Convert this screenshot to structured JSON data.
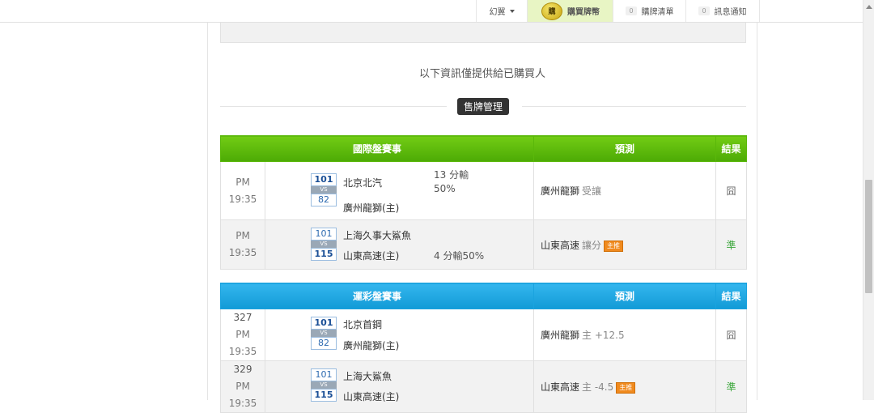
{
  "topbar": {
    "menu_label": "幻翼",
    "buy_coin_icon": "coin-icon",
    "buy_coin_text": "購",
    "buy_label": "購買牌幣",
    "list_count": "0",
    "list_label": "購牌清單",
    "msg_count": "0",
    "msg_label": "訊息通知"
  },
  "main": {
    "info_text": "以下資訊僅提供給已購買人",
    "manage_label": "售牌管理"
  },
  "intl_table": {
    "header": "國際盤賽事",
    "pred_header": "預測",
    "result_header": "結果",
    "rows": [
      {
        "time": "PM 19:35",
        "score_top": "101",
        "score_bottom": "82",
        "vs": "VS",
        "team1": "北京北汽",
        "team2": "廣州龍獅(主)",
        "odds_line1": "13 分輸",
        "odds_line2": "50%",
        "pred_team": "廣州龍獅",
        "pred_sub": "受讓",
        "pred_tag": "",
        "result": "囧"
      },
      {
        "time": "PM 19:35",
        "score_top": "101",
        "score_bottom": "115",
        "vs": "VS",
        "team1": "上海久事大鯊魚",
        "team2": "山東高速(主)",
        "odds_line1": "",
        "odds_line2": "4 分輸50%",
        "pred_team": "山東高速",
        "pred_sub": "讓分",
        "pred_tag": "主推",
        "result": "準"
      }
    ]
  },
  "lottery_table": {
    "header": "運彩盤賽事",
    "pred_header": "預測",
    "result_header": "結果",
    "rows": [
      {
        "num": "327",
        "time": "PM 19:35",
        "score_top": "101",
        "score_bottom": "82",
        "vs": "VS",
        "team1": "北京首鋼",
        "team2": "廣州龍獅(主)",
        "pred_team": "廣州龍獅",
        "pred_sub": "主 +12.5",
        "pred_tag": "",
        "result": "囧"
      },
      {
        "num": "329",
        "time": "PM 19:35",
        "score_top": "101",
        "score_bottom": "115",
        "vs": "VS",
        "team1": "上海大鯊魚",
        "team2": "山東高速(主)",
        "pred_team": "山東高速",
        "pred_sub": "主 -4.5",
        "pred_tag": "主推",
        "result": "準"
      }
    ]
  },
  "colors": {
    "green_header": "#5cb80a",
    "blue_header": "#1ea4e0",
    "tag_orange": "#f08a1e",
    "result_ok": "#3aa63a"
  }
}
